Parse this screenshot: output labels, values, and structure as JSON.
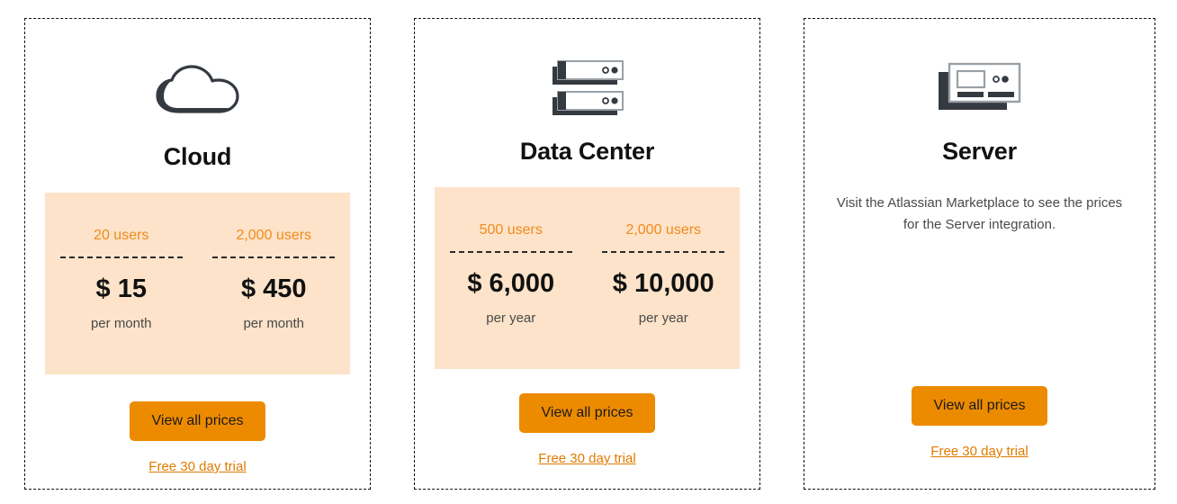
{
  "cards": [
    {
      "id": "cloud",
      "icon": "cloud-icon",
      "title": "Cloud",
      "tiers": [
        {
          "users": "20 users",
          "price": "$ 15",
          "period": "per month"
        },
        {
          "users": "2,000 users",
          "price": "$ 450",
          "period": "per month"
        }
      ],
      "cta_label": "View all prices",
      "trial_label": "Free 30 day trial"
    },
    {
      "id": "datacenter",
      "icon": "data-center-icon",
      "title": "Data Center",
      "tiers": [
        {
          "users": "500 users",
          "price": "$ 6,000",
          "period": "per year"
        },
        {
          "users": "2,000 users",
          "price": "$ 10,000",
          "period": "per year"
        }
      ],
      "cta_label": "View all prices",
      "trial_label": "Free 30 day trial"
    },
    {
      "id": "server",
      "icon": "server-icon",
      "title": "Server",
      "description": "Visit the Atlassian Marketplace to see the prices for the Server integration.",
      "cta_label": "View all prices",
      "trial_label": "Free 30 day trial"
    }
  ],
  "colors": {
    "accent_orange": "#ED8B00",
    "label_orange": "#F18A1C",
    "link_orange": "#E07B00",
    "panel_bg": "#FCE3C9",
    "icon_dark": "#343A40",
    "text_dark": "#111111",
    "text_muted": "#4a4a4a",
    "card_border": "#111111"
  }
}
